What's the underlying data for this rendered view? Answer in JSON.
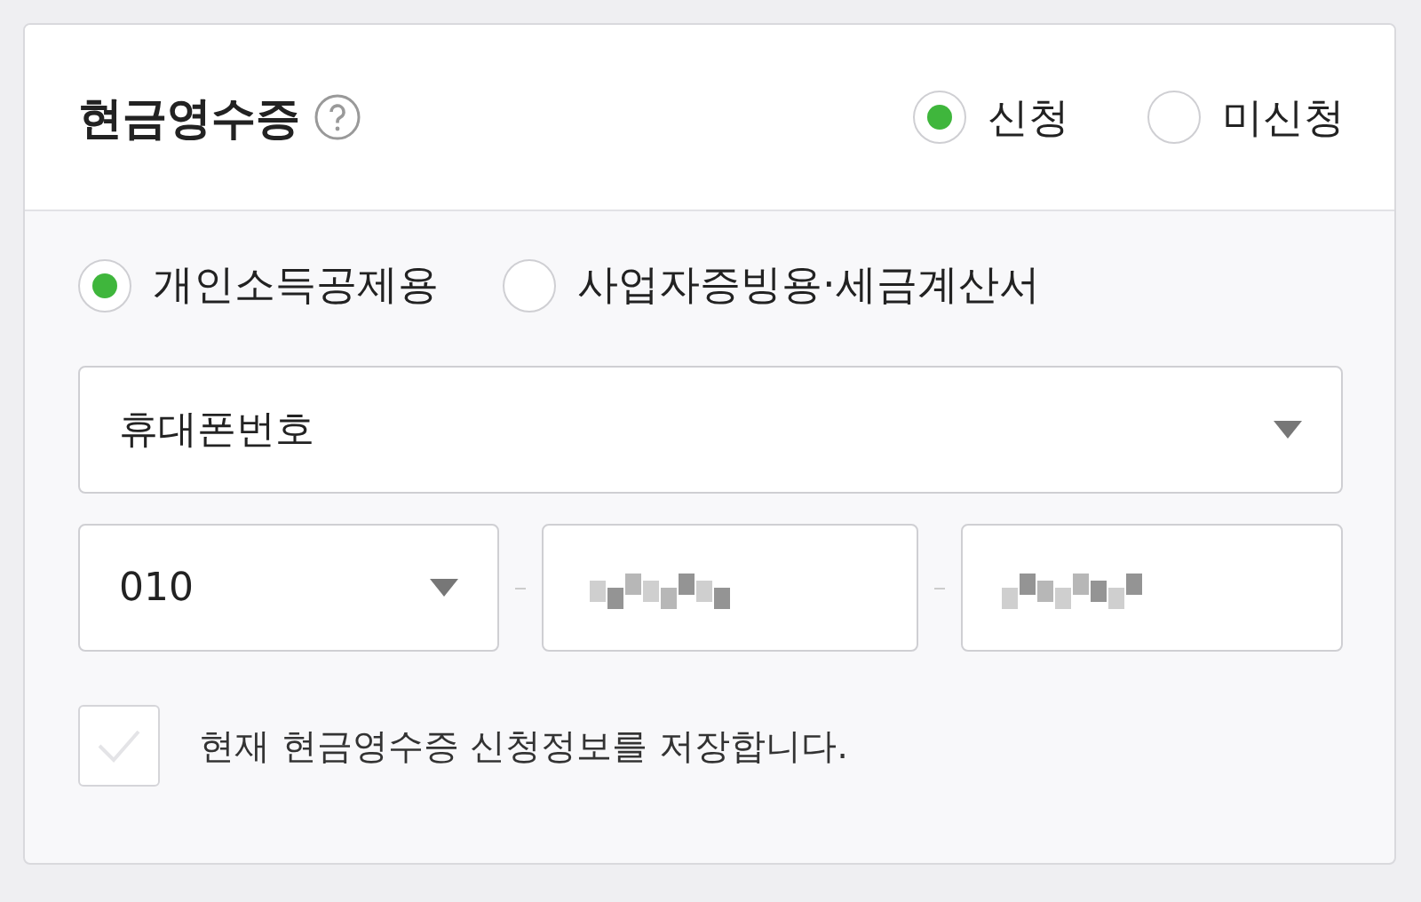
{
  "section": {
    "title": "현금영수증",
    "apply_options": [
      {
        "label": "신청",
        "selected": true
      },
      {
        "label": "미신청",
        "selected": false
      }
    ]
  },
  "receipt_types": [
    {
      "label": "개인소득공제용",
      "selected": true
    },
    {
      "label": "사업자증빙용·세금계산서",
      "selected": false
    }
  ],
  "id_type": {
    "value": "휴대폰번호"
  },
  "phone": {
    "prefix": "010",
    "middle_masked": true,
    "last_masked": true
  },
  "save_info": {
    "label": "현재 현금영수증 신청정보를 저장합니다.",
    "checked": false
  }
}
